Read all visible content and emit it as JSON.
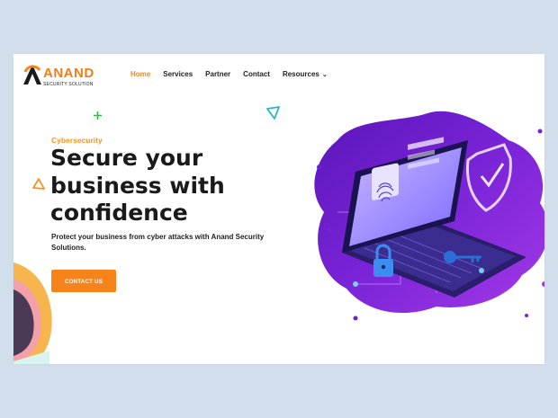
{
  "brand": {
    "name": "ANAND",
    "tagline": "SECURITY SOLUTION",
    "accent": "#f7841a"
  },
  "nav": {
    "items": [
      "Home",
      "Services",
      "Partner",
      "Contact",
      "Resources"
    ],
    "active": "Home",
    "dropdown_icon": "chevron-down-icon"
  },
  "hero": {
    "kicker": "Cybersecurity",
    "headline_lines": [
      "Secure your",
      "business with",
      "confidence"
    ],
    "subtext": "Protect your business from cyber attacks with Anand Security Solutions.",
    "cta_label": "CONTACT US"
  },
  "colors": {
    "background": "#d3deed",
    "cta": "#f7841a",
    "illustration_purple": "#6a1fc9"
  },
  "icons": [
    "plus-icon",
    "triangle-outline-icon",
    "laptop-security-illustration"
  ]
}
